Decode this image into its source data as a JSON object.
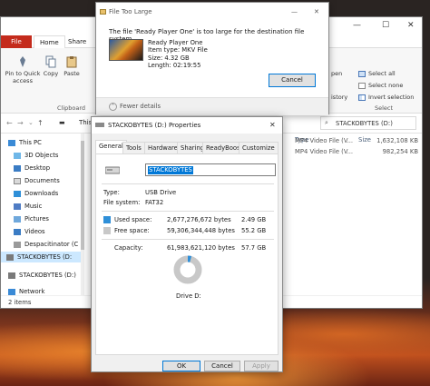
{
  "explorer": {
    "tabs": [
      "File",
      "Home",
      "Share"
    ],
    "ribbon_left": {
      "pin_label": "Pin to Quick access",
      "copy_label": "Copy",
      "paste_label": "Paste",
      "clipboard_label": "Clipboard"
    },
    "ribbon_right": {
      "open_label": "pen",
      "select_all": "Select all",
      "select_none": "Select none",
      "invert_selection": "Invert selection",
      "history_label": "istory",
      "select_label": "Select"
    },
    "address_partial": "This P",
    "address_drive": "STACKOBYTES (D:)",
    "nav_items": [
      "This PC",
      "3D Objects",
      "Desktop",
      "Documents",
      "Downloads",
      "Music",
      "Pictures",
      "Videos",
      "Despacitinator (C",
      "STACKOBYTES (D:",
      "STACKOBYTES (D:)",
      "Network"
    ],
    "columns": {
      "type": "Type",
      "size": "Size"
    },
    "files": [
      {
        "type": "MP4 Video File (V...",
        "size": "1,632,108 KB"
      },
      {
        "type": "MP4 Video File (V...",
        "size": "982,254 KB"
      }
    ],
    "status": "2 items"
  },
  "toolarge": {
    "title": "File Too Large",
    "message": "The file 'Ready Player One' is too large for the destination file system.",
    "file_name": "Ready Player One",
    "file_type": "Item type: MKV File",
    "file_size": "Size: 4.32 GB",
    "file_length": "Length: 02:19:55",
    "cancel_label": "Cancel",
    "fewer_details": "Fewer details"
  },
  "properties": {
    "title": "STACKOBYTES (D:) Properties",
    "tabs": [
      "General",
      "Tools",
      "Hardware",
      "Sharing",
      "ReadyBoost",
      "Customize"
    ],
    "name_value": "STACKOBYTES",
    "type_label": "Type:",
    "type_value": "USB Drive",
    "fs_label": "File system:",
    "fs_value": "FAT32",
    "used_label": "Used space:",
    "used_bytes": "2,677,276,672 bytes",
    "used_gb": "2.49 GB",
    "free_label": "Free space:",
    "free_bytes": "59,306,344,448 bytes",
    "free_gb": "55.2 GB",
    "capacity_label": "Capacity:",
    "capacity_bytes": "61,983,621,120 bytes",
    "capacity_gb": "57.7 GB",
    "drive_label": "Drive D:",
    "used_fraction": 0.043,
    "ok_label": "OK",
    "cancel_label": "Cancel",
    "apply_label": "Apply",
    "used_color": "#2f8fd8",
    "free_color": "#c8c8c8"
  }
}
